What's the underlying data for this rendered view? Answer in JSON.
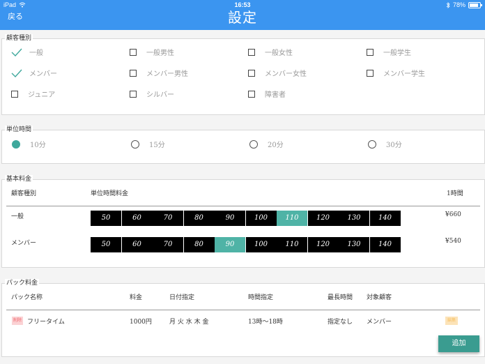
{
  "status": {
    "device": "iPad",
    "time": "16:53",
    "battery": "78%"
  },
  "header": {
    "back": "戻る",
    "title": "設定"
  },
  "customer_types": {
    "legend": "顧客種別",
    "options": [
      {
        "label": "一般",
        "checked": true
      },
      {
        "label": "一般男性",
        "checked": false
      },
      {
        "label": "一般女性",
        "checked": false
      },
      {
        "label": "一般学生",
        "checked": false
      },
      {
        "label": "メンバー",
        "checked": true
      },
      {
        "label": "メンバー男性",
        "checked": false
      },
      {
        "label": "メンバー女性",
        "checked": false
      },
      {
        "label": "メンバー学生",
        "checked": false
      },
      {
        "label": "ジュニア",
        "checked": false
      },
      {
        "label": "シルバー",
        "checked": false
      },
      {
        "label": "障害者",
        "checked": false
      }
    ]
  },
  "unit_time": {
    "legend": "単位時間",
    "options": [
      {
        "label": "10分",
        "selected": true
      },
      {
        "label": "15分",
        "selected": false
      },
      {
        "label": "20分",
        "selected": false
      },
      {
        "label": "30分",
        "selected": false
      }
    ]
  },
  "basic_fee": {
    "legend": "基本料金",
    "col_customer": "顧客種別",
    "col_rate": "単位時間料金",
    "col_hour": "1時間",
    "rows": [
      {
        "name": "一般",
        "rates": [
          "50",
          "60",
          "70",
          "80",
          "90",
          "100",
          "110",
          "120",
          "130",
          "140"
        ],
        "selected": "110",
        "hour": "¥660"
      },
      {
        "name": "メンバー",
        "rates": [
          "50",
          "60",
          "70",
          "80",
          "90",
          "100",
          "110",
          "120",
          "130",
          "140"
        ],
        "selected": "90",
        "hour": "¥540"
      }
    ]
  },
  "pack_fee": {
    "legend": "パック料金",
    "headers": {
      "name": "パック名称",
      "price": "料金",
      "date": "日付指定",
      "time": "時間指定",
      "max": "最長時間",
      "target": "対象顧客"
    },
    "rows": [
      {
        "tag": "削除",
        "name": "フリータイム",
        "price": "1000円",
        "date": "月 火 水 木 金",
        "time": "13時〜18時",
        "max": "指定なし",
        "target": "メンバー",
        "edit": "編集"
      }
    ]
  },
  "add_button": "追加",
  "colors": {
    "header": "#3b95f0",
    "accent": "#3fa89c",
    "rate_bg": "#000000",
    "rate_selected": "#4fb3a6"
  }
}
